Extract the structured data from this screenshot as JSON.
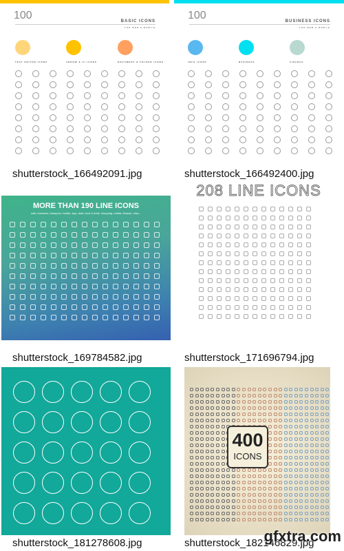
{
  "items": [
    {
      "caption": "shutterstock_166492091.jpg",
      "brand": "100",
      "title": "BASIC ICONS",
      "accent": "#ffc200",
      "subtitle": "FOR WEB & MOBILE",
      "labels": [
        "TEXT EDITOR ICONS",
        "ARROW & UI ICONS",
        "DOCUMENT & FOLDER ICONS"
      ]
    },
    {
      "caption": "shutterstock_166492400.jpg",
      "brand": "100",
      "title": "BUSINESS ICONS",
      "accent": "#00e0f0",
      "subtitle": "FOR WEB & MOBILE",
      "labels": [
        "INFO ICONS",
        "BUSINESS",
        "FINANCE"
      ]
    },
    {
      "caption": "shutterstock_169784582.jpg",
      "title": "MORE THAN 190 LINE ICONS",
      "subtitle": "web, business, transport, mobile, app, data, food & drink, shopping, media, finance, misc..."
    },
    {
      "caption": "shutterstock_171696794.jpg",
      "title": "208 LINE ICONS"
    },
    {
      "caption": "shutterstock_181278608.jpg",
      "bg": "#12a89a"
    },
    {
      "caption": "shutterstock_182146829.jpg",
      "badge_number": "400",
      "badge_label": "ICONS"
    }
  ],
  "watermark": "gfxtra.com"
}
